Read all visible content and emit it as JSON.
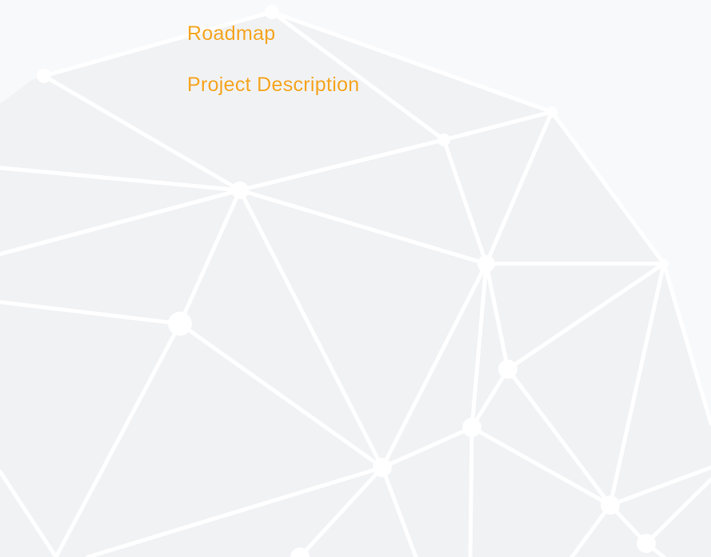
{
  "theme": {
    "accent_color": "#f5a623",
    "background_color": "#f8f9fa",
    "pattern_fill_color": "#f1f2f4",
    "pattern_line_color": "#ffffff"
  },
  "nav": {
    "items": [
      {
        "label": "Roadmap"
      },
      {
        "label": "Project Description"
      }
    ]
  }
}
